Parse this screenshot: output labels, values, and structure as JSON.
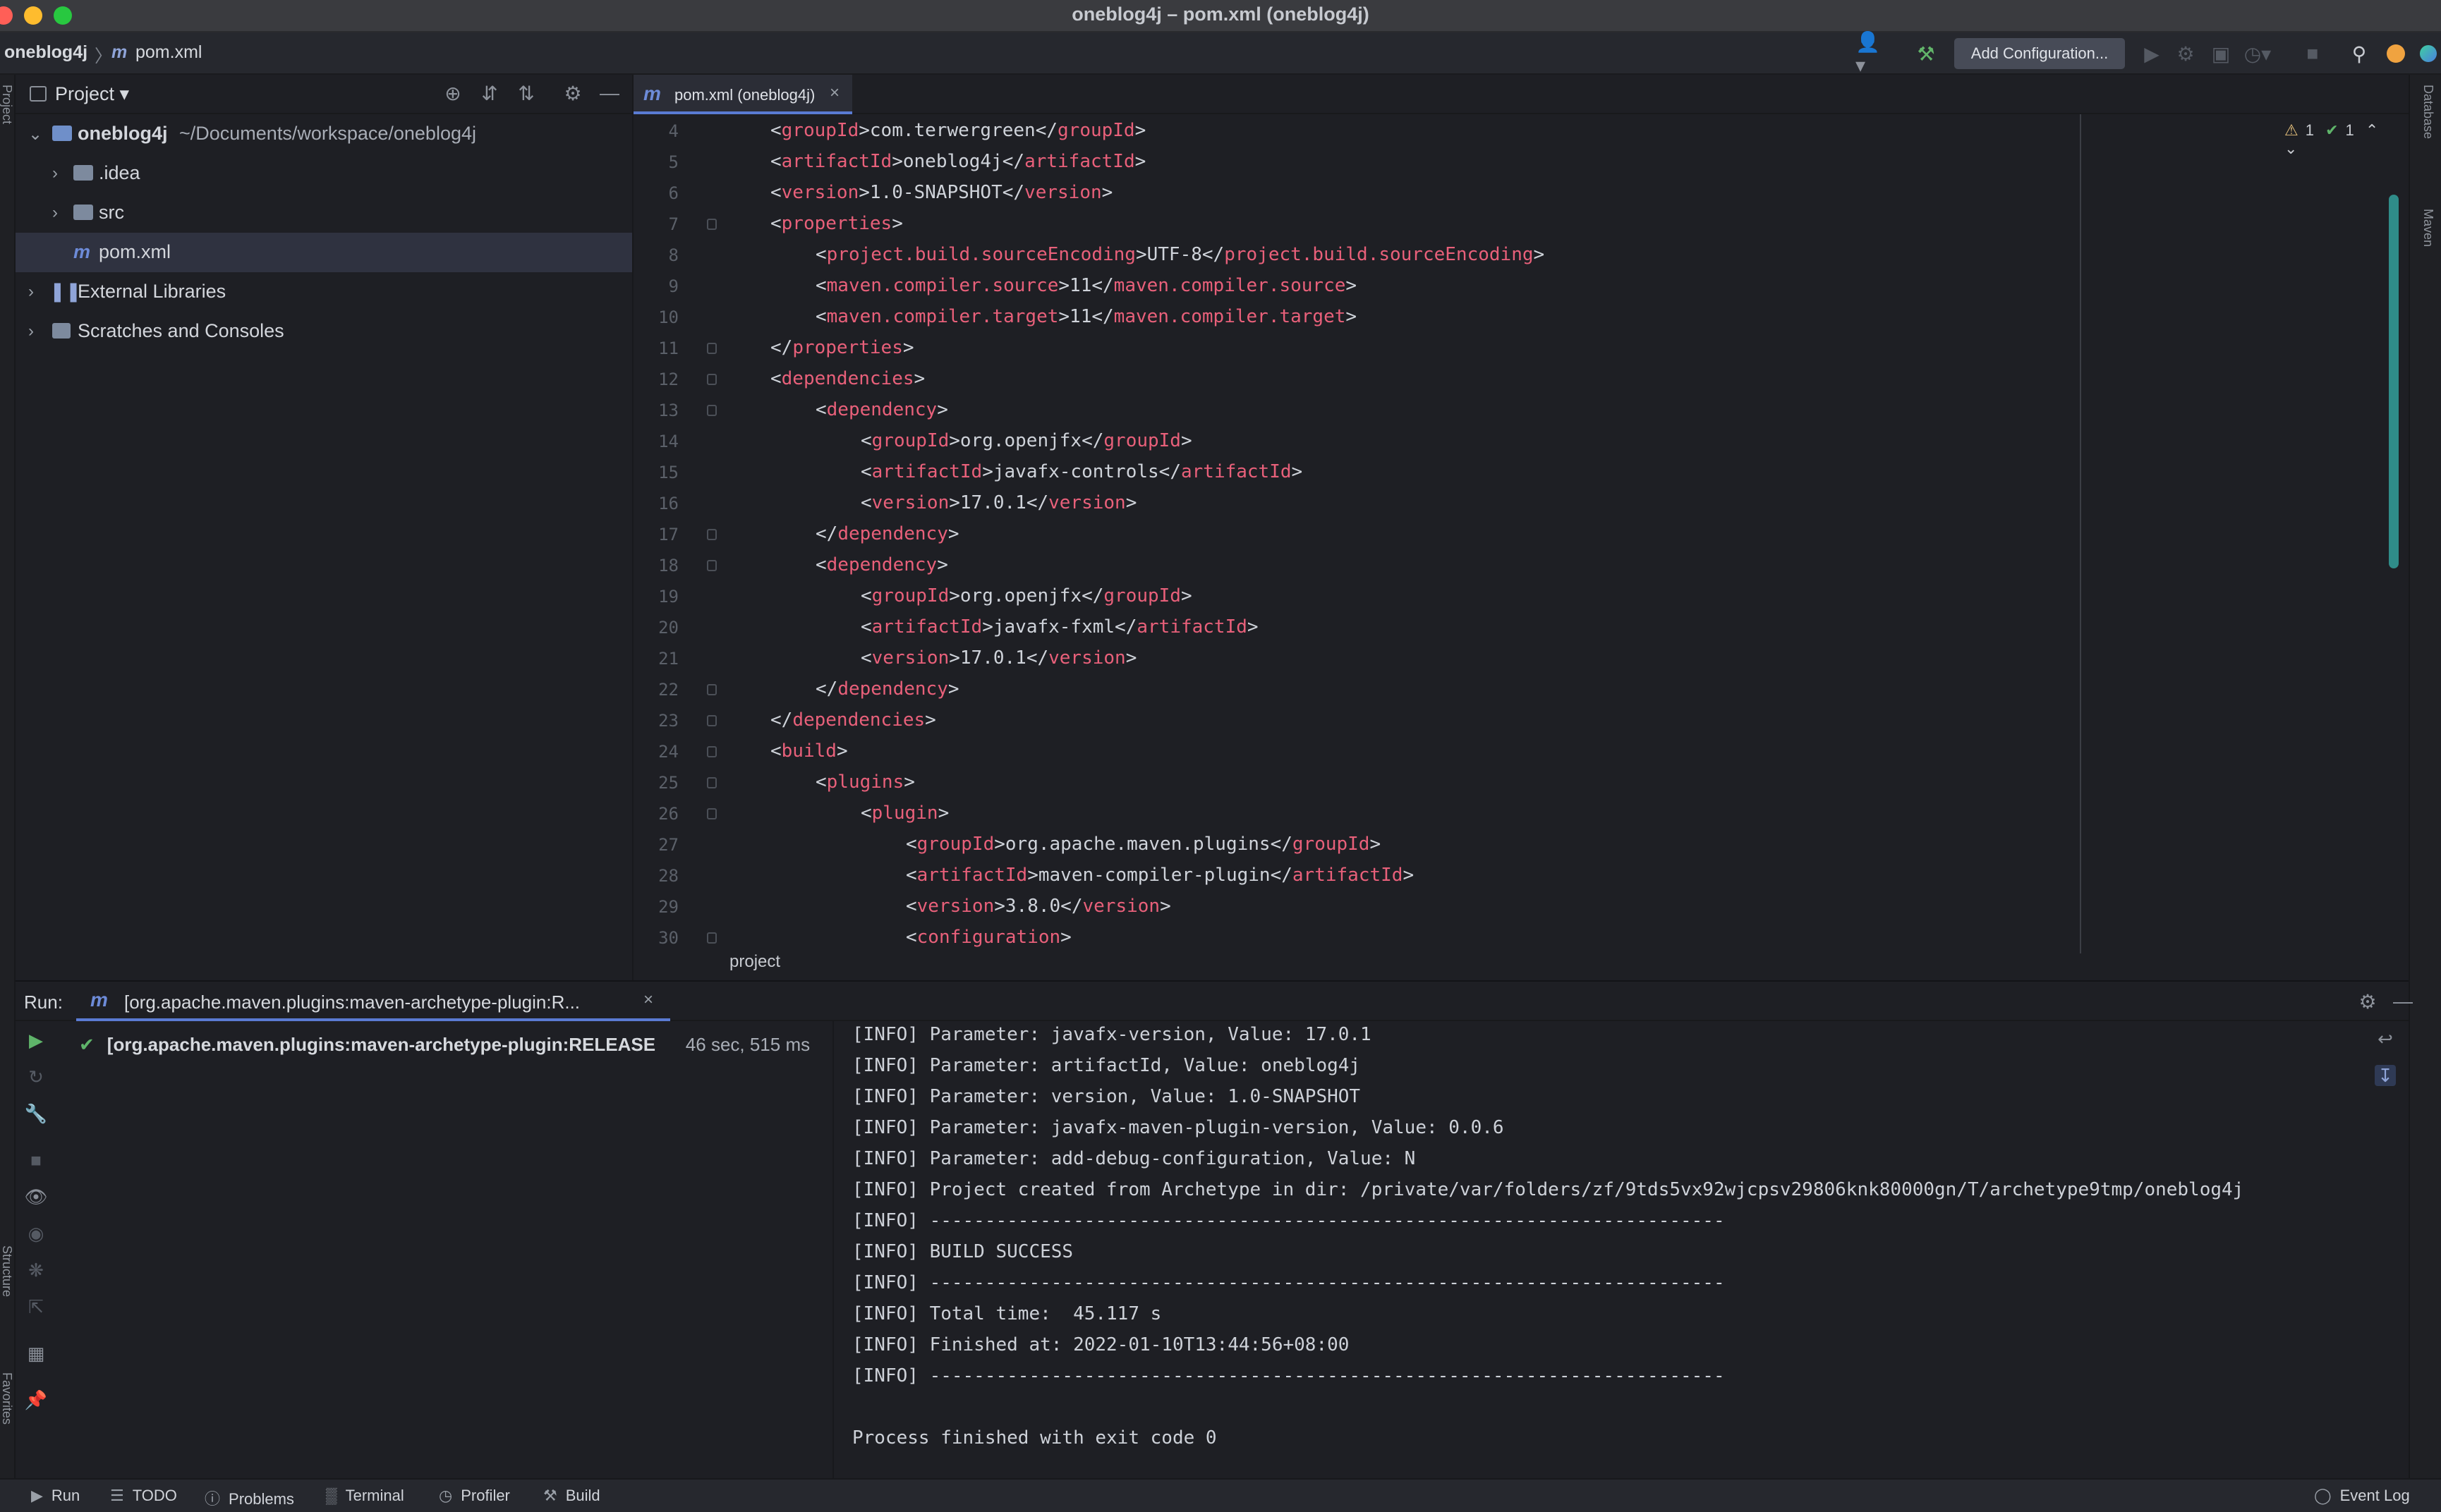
{
  "window": {
    "title": "oneblog4j – pom.xml (oneblog4j)"
  },
  "navbar": {
    "project": "oneblog4j",
    "file": "pom.xml",
    "add_configuration": "Add Configuration..."
  },
  "project_panel": {
    "title": "Project",
    "tree": [
      {
        "label": "oneblog4j",
        "detail": "~/Documents/workspace/oneblog4j"
      },
      {
        "label": ".idea"
      },
      {
        "label": "src"
      },
      {
        "label": "pom.xml"
      },
      {
        "label": "External Libraries"
      },
      {
        "label": "Scratches and Consoles"
      }
    ]
  },
  "side_tabs": {
    "project": "Project",
    "structure": "Structure",
    "favorites": "Favorites",
    "database": "Database",
    "maven": "Maven"
  },
  "editor": {
    "tab_label": "pom.xml (oneblog4j)",
    "breadcrumb": "project",
    "inspections": {
      "warnings": "1",
      "ok": "1"
    },
    "lines": [
      {
        "n": "4",
        "indent": 1,
        "open": "groupId",
        "text": "com.terwergreen",
        "close": "groupId"
      },
      {
        "n": "5",
        "indent": 1,
        "open": "artifactId",
        "text": "oneblog4j",
        "close": "artifactId"
      },
      {
        "n": "6",
        "indent": 1,
        "open": "version",
        "text": "1.0-SNAPSHOT",
        "close": "version"
      },
      {
        "n": "7",
        "indent": 1,
        "open": "properties",
        "fold": true
      },
      {
        "n": "8",
        "indent": 2,
        "open": "project.build.sourceEncoding",
        "text": "UTF-8",
        "close": "project.build.sourceEncoding"
      },
      {
        "n": "9",
        "indent": 2,
        "open": "maven.compiler.source",
        "text": "11",
        "close": "maven.compiler.source"
      },
      {
        "n": "10",
        "indent": 2,
        "open": "maven.compiler.target",
        "text": "11",
        "close": "maven.compiler.target"
      },
      {
        "n": "11",
        "indent": 1,
        "close": "properties",
        "fold": true
      },
      {
        "n": "12",
        "indent": 1,
        "open": "dependencies",
        "fold": true
      },
      {
        "n": "13",
        "indent": 2,
        "open": "dependency",
        "fold": true
      },
      {
        "n": "14",
        "indent": 3,
        "open": "groupId",
        "text": "org.openjfx",
        "close": "groupId"
      },
      {
        "n": "15",
        "indent": 3,
        "open": "artifactId",
        "text": "javafx-controls",
        "close": "artifactId"
      },
      {
        "n": "16",
        "indent": 3,
        "open": "version",
        "text": "17.0.1",
        "close": "version"
      },
      {
        "n": "17",
        "indent": 2,
        "close": "dependency",
        "fold": true
      },
      {
        "n": "18",
        "indent": 2,
        "open": "dependency",
        "fold": true
      },
      {
        "n": "19",
        "indent": 3,
        "open": "groupId",
        "text": "org.openjfx",
        "close": "groupId"
      },
      {
        "n": "20",
        "indent": 3,
        "open": "artifactId",
        "text": "javafx-fxml",
        "close": "artifactId"
      },
      {
        "n": "21",
        "indent": 3,
        "open": "version",
        "text": "17.0.1",
        "close": "version"
      },
      {
        "n": "22",
        "indent": 2,
        "close": "dependency",
        "fold": true
      },
      {
        "n": "23",
        "indent": 1,
        "close": "dependencies",
        "fold": true
      },
      {
        "n": "24",
        "indent": 1,
        "open": "build",
        "fold": true
      },
      {
        "n": "25",
        "indent": 2,
        "open": "plugins",
        "fold": true
      },
      {
        "n": "26",
        "indent": 3,
        "open": "plugin",
        "fold": true
      },
      {
        "n": "27",
        "indent": 4,
        "open": "groupId",
        "text": "org.apache.maven.plugins",
        "close": "groupId"
      },
      {
        "n": "28",
        "indent": 4,
        "open": "artifactId",
        "text": "maven-compiler-plugin",
        "close": "artifactId"
      },
      {
        "n": "29",
        "indent": 4,
        "open": "version",
        "text": "3.8.0",
        "close": "version"
      },
      {
        "n": "30",
        "indent": 4,
        "open": "configuration",
        "fold": true
      }
    ]
  },
  "run_panel": {
    "label": "Run:",
    "tab_label": "[org.apache.maven.plugins:maven-archetype-plugin:R...",
    "item_name": "[org.apache.maven.plugins:maven-archetype-plugin:RELEASE",
    "item_duration": "46 sec, 515 ms",
    "console": [
      "[INFO] Parameter: javafx-version, Value: 17.0.1",
      "[INFO] Parameter: artifactId, Value: oneblog4j",
      "[INFO] Parameter: version, Value: 1.0-SNAPSHOT",
      "[INFO] Parameter: javafx-maven-plugin-version, Value: 0.0.6",
      "[INFO] Parameter: add-debug-configuration, Value: N",
      "[INFO] Project created from Archetype in dir: /private/var/folders/zf/9tds5vx92wjcpsv29806knk80000gn/T/archetype9tmp/oneblog4j",
      "[INFO] ------------------------------------------------------------------------",
      "[INFO] BUILD SUCCESS",
      "[INFO] ------------------------------------------------------------------------",
      "[INFO] Total time:  45.117 s",
      "[INFO] Finished at: 2022-01-10T13:44:56+08:00",
      "[INFO] ------------------------------------------------------------------------",
      "",
      "Process finished with exit code 0"
    ]
  },
  "statusbar": {
    "run": "Run",
    "todo": "TODO",
    "problems": "Problems",
    "terminal": "Terminal",
    "profiler": "Profiler",
    "build": "Build",
    "event_log": "Event Log"
  },
  "colors": {
    "background": "#1e1f24",
    "tag": "#e8607a",
    "accent": "#5a7bd3",
    "success": "#5fb46a"
  }
}
